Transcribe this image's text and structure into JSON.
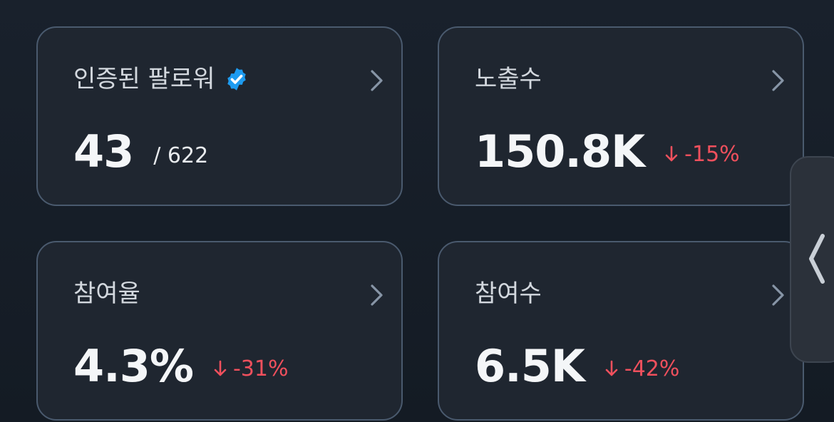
{
  "cards": [
    {
      "title": "인증된 팔로워",
      "value": "43",
      "total": "/ 622",
      "verified_icon": "verified-badge-icon",
      "badge_color": "#1d9bf0"
    },
    {
      "title": "노출수",
      "value": "150.8K",
      "delta": "-15%",
      "trend": "down"
    },
    {
      "title": "참여율",
      "value": "4.3%",
      "delta": "-31%",
      "trend": "down"
    },
    {
      "title": "참여수",
      "value": "6.5K",
      "delta": "-42%",
      "trend": "down"
    }
  ],
  "icons": {
    "card_chevron": "chevron-right-icon",
    "delta_arrow": "arrow-down-icon",
    "side_handle": "chevron-left-icon"
  },
  "colors": {
    "background": "#161d26",
    "card_bg": "#1f2630",
    "card_border": "#4a5a6e",
    "negative": "#f0505d",
    "verified": "#1d9bf0"
  }
}
